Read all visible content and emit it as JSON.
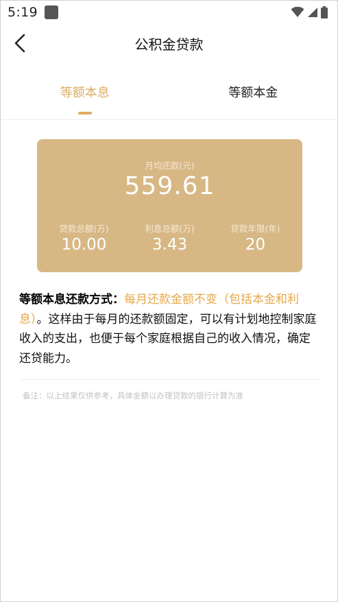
{
  "status_bar": {
    "time": "5:19",
    "icons": [
      "app-notification-icon",
      "wifi-icon",
      "signal-icon",
      "battery-icon"
    ]
  },
  "header": {
    "title": "公积金贷款",
    "back_icon": "chevron-left-icon"
  },
  "tabs": [
    {
      "label": "等额本息",
      "active": true
    },
    {
      "label": "等额本金",
      "active": false
    }
  ],
  "summary": {
    "monthly_label": "月均还款(元)",
    "monthly_value": "559.61",
    "stats": [
      {
        "label": "贷款总额(万)",
        "value": "10.00"
      },
      {
        "label": "利息总额(万)",
        "value": "3.43"
      },
      {
        "label": "贷款年限(年)",
        "value": "20"
      }
    ]
  },
  "description": {
    "title": "等额本息还款方式：",
    "highlight": "每月还款金额不变（包括本金和利息）",
    "body": "。这样由于每月的还款额固定，可以有计划地控制家庭收入的支出，也便于每个家庭根据自己的收入情况，确定还贷能力。"
  },
  "note": "备注：以上结果仅供参考，具体金额以办理贷款的银行计算为准",
  "colors": {
    "accent": "#dcae62",
    "card_bg": "#d7b885",
    "highlight_text": "#e6a84a"
  }
}
